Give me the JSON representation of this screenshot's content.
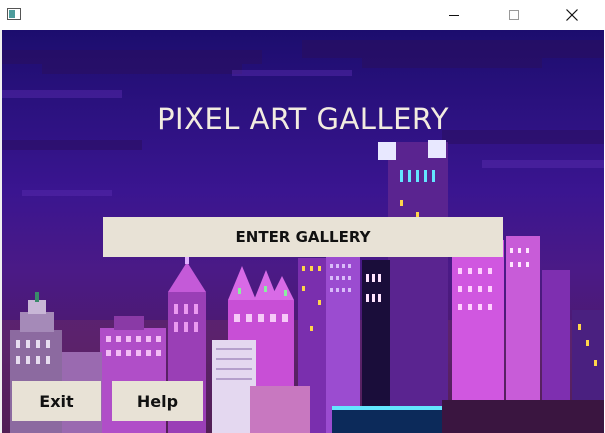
{
  "window": {
    "title": "",
    "controls": {
      "minimize": "minimize",
      "maximize": "maximize",
      "close": "close"
    }
  },
  "main": {
    "title": "PIXEL ART GALLERY",
    "enter_label": "ENTER GALLERY",
    "exit_label": "Exit",
    "help_label": "Help"
  },
  "colors": {
    "sky_top": "#1c0d6e",
    "sky_mid": "#3a1590",
    "button_bg": "#e8e2d6",
    "title_text": "#f2ece0",
    "building_magenta": "#c44bd8",
    "building_purple": "#7a2fae",
    "window_yellow": "#ffd64a",
    "window_cyan": "#63e6ff"
  }
}
